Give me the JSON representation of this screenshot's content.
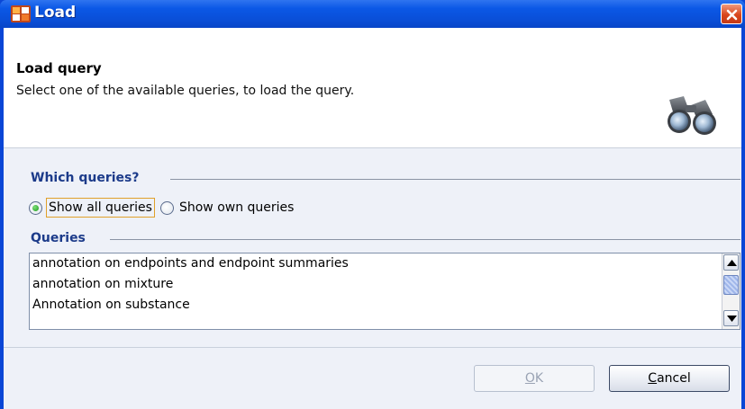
{
  "window": {
    "title": "Load",
    "close_icon": "close-icon",
    "app_icon": "app-logo-icon"
  },
  "header": {
    "title": "Load query",
    "description": "Select one of the available queries, to load the query.",
    "icon": "binoculars-icon"
  },
  "which_queries": {
    "title": "Which queries?",
    "options": [
      {
        "label": "Show all queries",
        "selected": true
      },
      {
        "label": "Show own queries",
        "selected": false
      }
    ]
  },
  "queries": {
    "title": "Queries",
    "items": [
      "annotation on endpoints and endpoint summaries",
      "annotation on mixture",
      "Annotation on substance"
    ]
  },
  "buttons": {
    "ok": {
      "mnemonic": "O",
      "rest": "K"
    },
    "cancel": {
      "mnemonic": "C",
      "rest": "ancel"
    }
  },
  "colors": {
    "title_bar": "#0b58e6",
    "section_title": "#1c3b8a",
    "close_button": "#d9461d",
    "dialog_background": "#eef1f8"
  }
}
